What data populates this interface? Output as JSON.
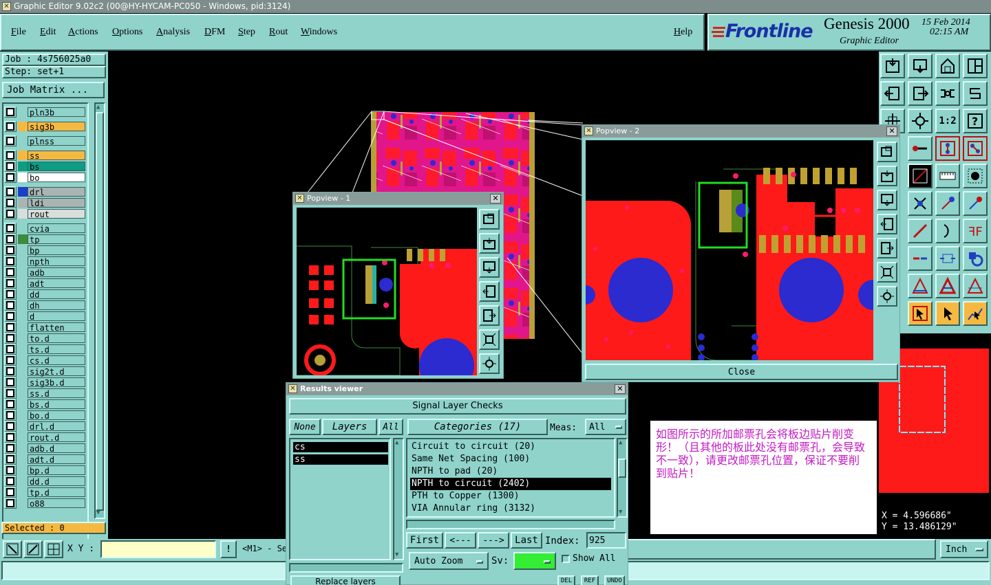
{
  "title_bar": "Graphic Editor 9.02c2 (00@HY-HYCAM-PC050 - Windows, pid:3124)",
  "menu": {
    "items": [
      "File",
      "Edit",
      "Actions",
      "Options",
      "Analysis",
      "DFM",
      "Step",
      "Rout",
      "Windows"
    ],
    "help": "Help"
  },
  "brand": {
    "logo": "Frontline",
    "product": "Genesis 2000",
    "subtitle": "Graphic Editor",
    "date": "15 Feb 2014",
    "time": "02:15 AM"
  },
  "left_panel": {
    "job": "Job : 4s756025a0",
    "step": "Step: set+1",
    "job_matrix": "Job Matrix ...",
    "layers_group1": [
      {
        "name": "pln3b",
        "color": "#8fd3cb"
      },
      {
        "name": "sig3b",
        "color": "#f5b942"
      },
      {
        "name": "plnss",
        "color": "#8fd3cb"
      },
      {
        "name": "ss",
        "color": "#f5b942"
      },
      {
        "name": "bs",
        "color": "#0f9c83"
      },
      {
        "name": "bo",
        "color": "#ffffff"
      }
    ],
    "layers_group2": [
      {
        "name": "drl",
        "color": "#a9b4b3"
      },
      {
        "name": "ldi",
        "color": "#a9b4b3"
      },
      {
        "name": "rout",
        "color": "#d9dddc"
      }
    ],
    "layers_group3": [
      "cvia",
      "tp",
      "bp",
      "npth",
      "adb",
      "adt",
      "dd",
      "dh",
      "d",
      "flatten",
      "to.d",
      "ts.d",
      "cs.d",
      "sig2t.d",
      "sig3b.d",
      "ss.d",
      "bs.d",
      "bo.d",
      "drl.d",
      "rout.d",
      "adb.d",
      "adt.d",
      "bp.d",
      "dd.d",
      "tp.d",
      "o88"
    ],
    "selected": "Selected : 0"
  },
  "bottom_bar": {
    "xy_label": "X Y :",
    "xy_value": "",
    "warn": "!",
    "mode_text": "<M1> - Se",
    "units": "Inch"
  },
  "popview1": {
    "title": "Popview - 1"
  },
  "popview2": {
    "title": "Popview - 2",
    "close": "Close"
  },
  "results": {
    "title": "Results viewer",
    "header": "Signal Layer Checks",
    "none": "None",
    "layers": "Layers",
    "all": "All",
    "categories": "Categories (17)",
    "meas": "Meas:",
    "meas_value": "All",
    "layer_list": [
      "cs",
      "ss"
    ],
    "category_list": [
      "Circuit to circuit (20)",
      "Same Net Spacing (100)",
      "NPTH to pad (20)",
      "NPTH to circuit (2402)",
      "PTH to Copper (1300)",
      "VIA Annular ring (3132)"
    ],
    "selected_category_index": 3,
    "first": "First",
    "prev": "<---",
    "next": "--->",
    "last": "Last",
    "index_label": "Index:",
    "index_value": "925",
    "auto_zoom": "Auto Zoom",
    "sv": "Sv:",
    "show_all": "Show All",
    "replace": "Replace layers",
    "del": "DEL",
    "ref": "REF",
    "undo": "UNDO"
  },
  "note": "如图所示的所加邮票孔会将板边贴片削变形！（且其他的板此处没有邮票孔，会导致不一致），请更改邮票孔位置，保证不要削到贴片！",
  "coords": {
    "x": "X = 4.596686\"",
    "y": "Y = 13.486129\""
  }
}
